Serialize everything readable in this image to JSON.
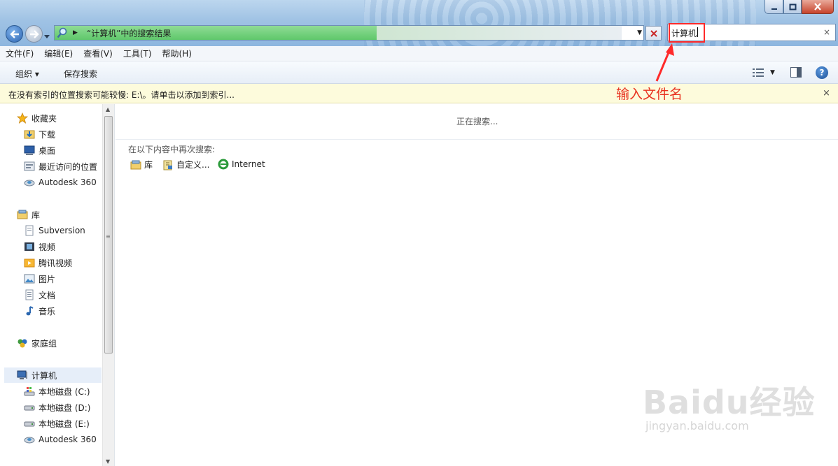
{
  "address_bar": {
    "text": "“计算机”中的搜索结果"
  },
  "search": {
    "value": "计算机",
    "clear_glyph": "×"
  },
  "menu": {
    "items": [
      "文件(F)",
      "编辑(E)",
      "查看(V)",
      "工具(T)",
      "帮助(H)"
    ]
  },
  "toolbar": {
    "organize": "组织 ▾",
    "save_search": "保存搜索",
    "help": "?"
  },
  "infobar": {
    "text": "在没有索引的位置搜索可能较慢: E:\\。请单击以添加到索引...",
    "close": "×"
  },
  "annotation": {
    "text": "输入文件名",
    "color": "#e8321f"
  },
  "nav": {
    "favorites": {
      "title": "收藏夹",
      "items": [
        "下载",
        "桌面",
        "最近访问的位置",
        "Autodesk 360"
      ]
    },
    "libraries": {
      "title": "库",
      "items": [
        "Subversion",
        "视频",
        "腾讯视频",
        "图片",
        "文档",
        "音乐"
      ]
    },
    "homegroup": {
      "title": "家庭组"
    },
    "computer": {
      "title": "计算机",
      "items": [
        "本地磁盘 (C:)",
        "本地磁盘 (D:)",
        "本地磁盘 (E:)",
        "Autodesk 360"
      ]
    }
  },
  "content": {
    "status": "正在搜索...",
    "search_again_label": "在以下内容中再次搜索:",
    "locations": [
      "库",
      "自定义...",
      "Internet"
    ]
  },
  "watermark": {
    "logo": "Baidu经验",
    "url": "jingyan.baidu.com"
  }
}
